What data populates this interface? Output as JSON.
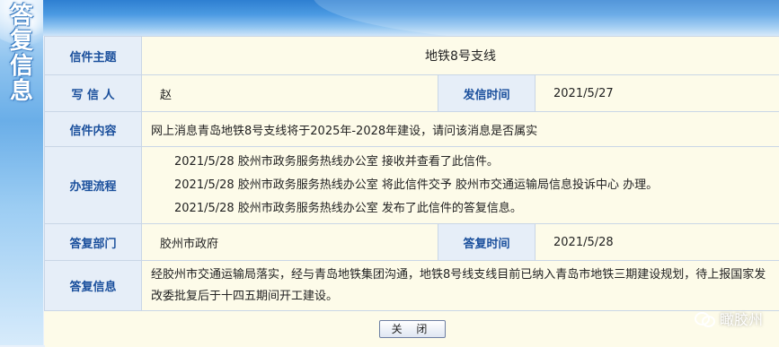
{
  "sidebar": {
    "title": "答复信息"
  },
  "rows": {
    "subject": {
      "label": "信件主题",
      "value": "地铁8号支线"
    },
    "writer": {
      "label": "写 信 人",
      "value": "赵",
      "time_label": "发信时间",
      "time_value": "2021/5/27"
    },
    "content": {
      "label": "信件内容",
      "value": "网上消息青岛地铁8号支线将于2025年-2028年建设，请问该消息是否属实"
    },
    "process": {
      "label": "办理流程",
      "steps": [
        "2021/5/28  胶州市政务服务热线办公室  接收并查看了此信件。",
        "2021/5/28  胶州市政务服务热线办公室  将此信件交予  胶州市交通运输局信息投诉中心  办理。",
        "2021/5/28  胶州市政务服务热线办公室  发布了此信件的答复信息。"
      ]
    },
    "dept": {
      "label": "答复部门",
      "value": "胶州市政府",
      "time_label": "答复时间",
      "time_value": "2021/5/28"
    },
    "reply": {
      "label": "答复信息",
      "value": "经胶州市交通运输局落实，经与青岛地铁集团沟通，地铁8号线支线目前已纳入青岛市地铁三期建设规划，待上报国家发改委批复后于十四五期间开工建设。"
    }
  },
  "close_button": "关 闭",
  "watermark": "瞰胶州"
}
